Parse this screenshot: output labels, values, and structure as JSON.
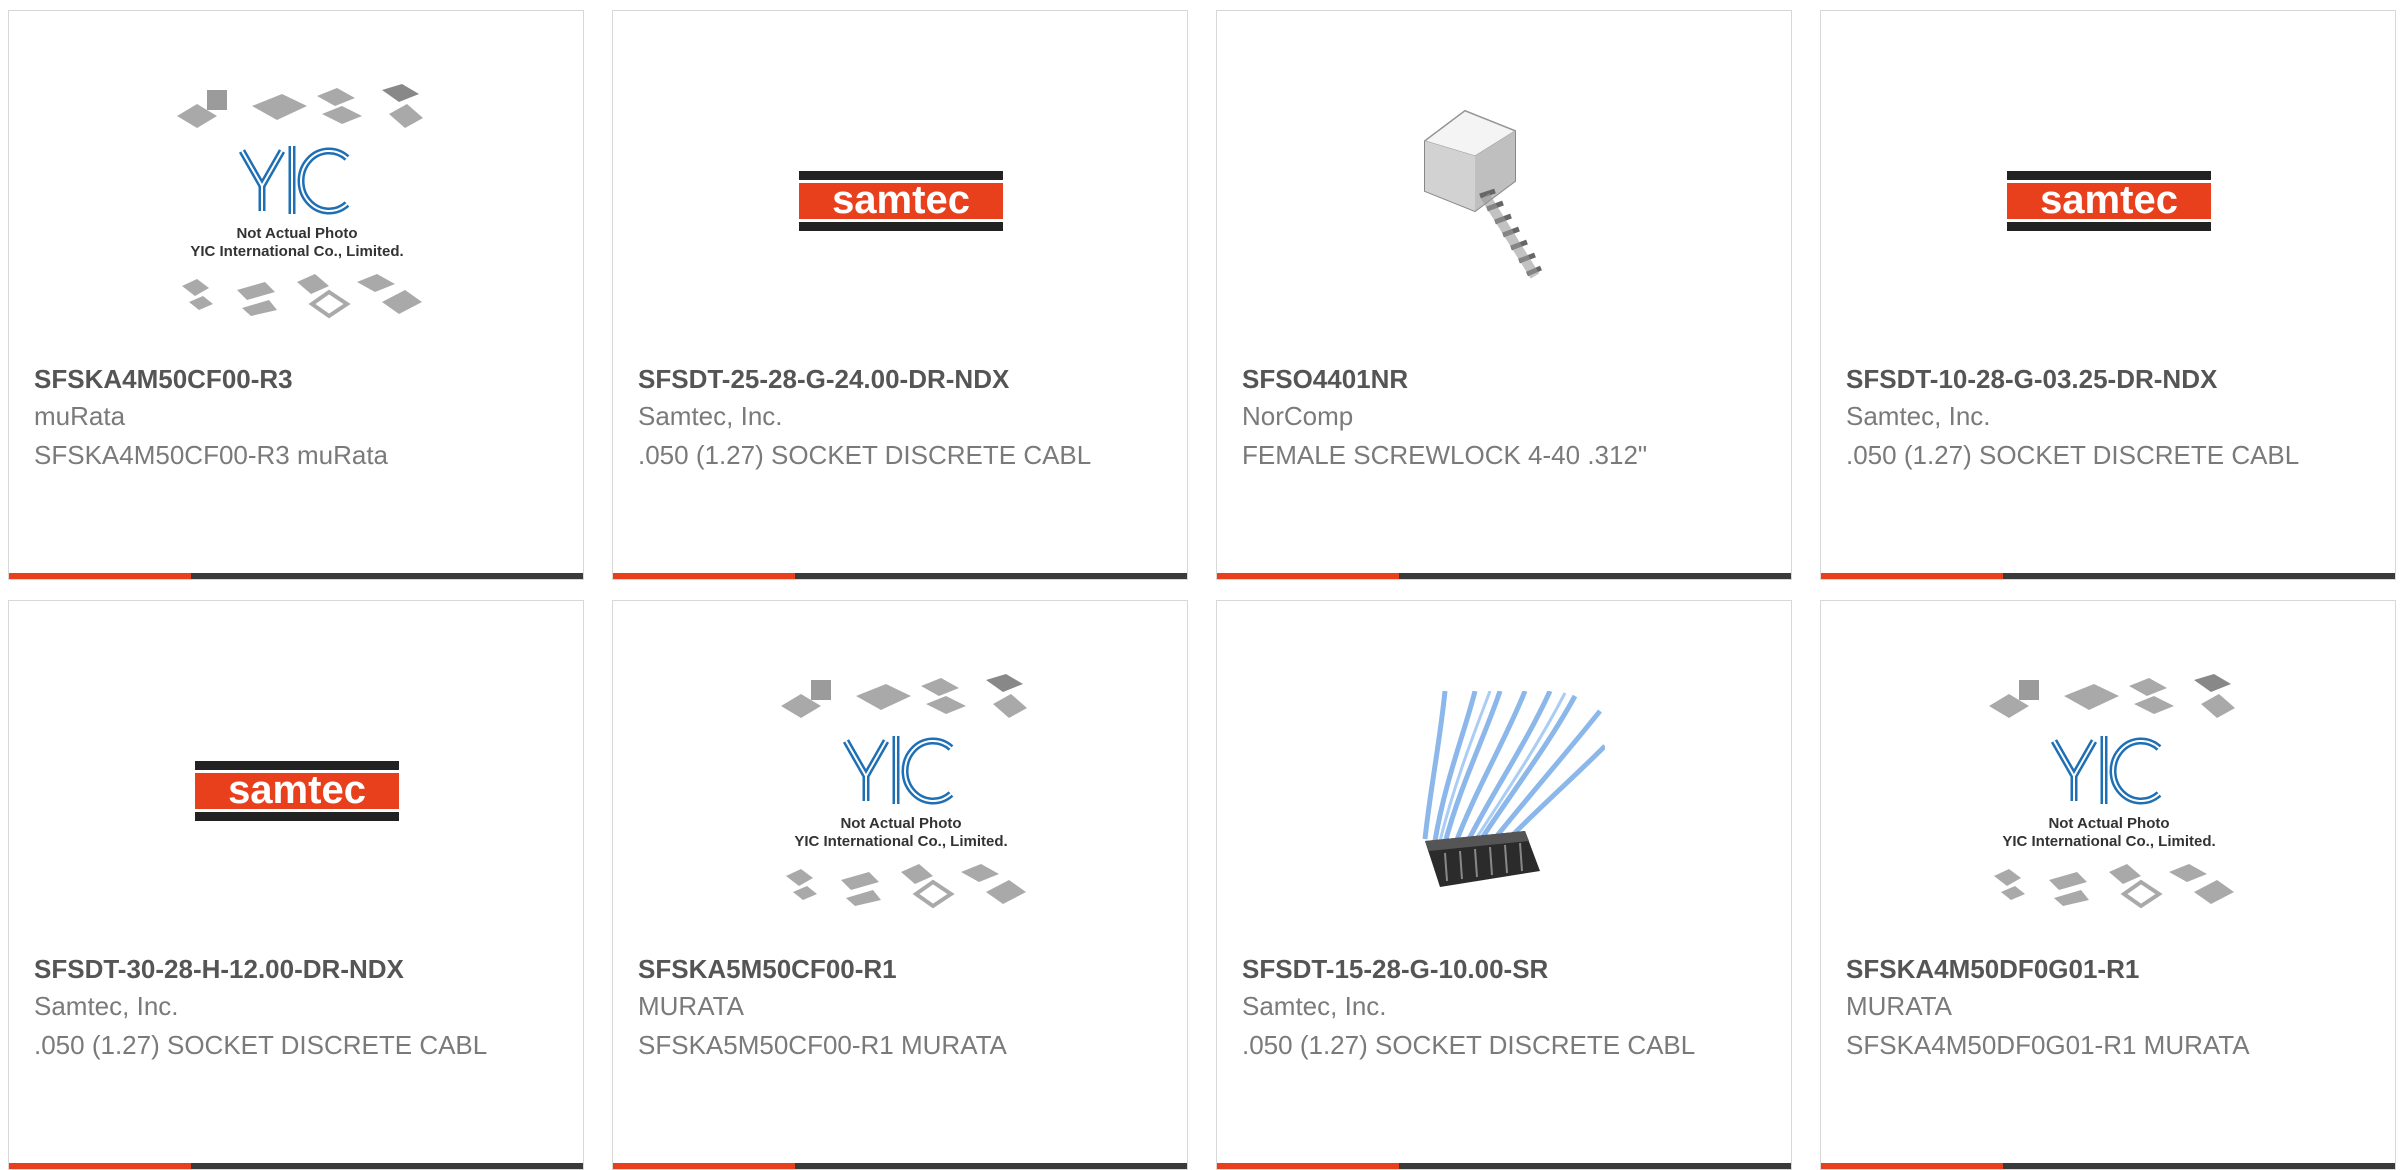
{
  "products": [
    {
      "part_number": "SFSKA4M50CF00-R3",
      "manufacturer": "muRata",
      "description": "SFSKA4M50CF00-R3 muRata",
      "image": "yic-placeholder-icon"
    },
    {
      "part_number": "SFSDT-25-28-G-24.00-DR-NDX",
      "manufacturer": "Samtec, Inc.",
      "description": ".050 (1.27) SOCKET DISCRETE CABL",
      "image": "samtec-logo"
    },
    {
      "part_number": "SFSO4401NR",
      "manufacturer": "NorComp",
      "description": "FEMALE SCREWLOCK 4-40 .312\"",
      "image": "screwlock-photo"
    },
    {
      "part_number": "SFSDT-10-28-G-03.25-DR-NDX",
      "manufacturer": "Samtec, Inc.",
      "description": ".050 (1.27) SOCKET DISCRETE CABL",
      "image": "samtec-logo"
    },
    {
      "part_number": "SFSDT-30-28-H-12.00-DR-NDX",
      "manufacturer": "Samtec, Inc.",
      "description": ".050 (1.27) SOCKET DISCRETE CABL",
      "image": "samtec-logo"
    },
    {
      "part_number": "SFSKA5M50CF00-R1",
      "manufacturer": "MURATA",
      "description": "SFSKA5M50CF00-R1 MURATA",
      "image": "yic-placeholder-icon"
    },
    {
      "part_number": "SFSDT-15-28-G-10.00-SR",
      "manufacturer": "Samtec, Inc.",
      "description": ".050 (1.27) SOCKET DISCRETE CABL",
      "image": "cable-assembly-photo"
    },
    {
      "part_number": "SFSKA4M50DF0G01-R1",
      "manufacturer": "MURATA",
      "description": "SFSKA4M50DF0G01-R1 MURATA",
      "image": "yic-placeholder-icon"
    }
  ],
  "logos": {
    "samtec_text": "samtec",
    "yic_text": "YIC",
    "yic_caption_1": "Not Actual Photo",
    "yic_caption_2": "YIC International Co., Limited."
  },
  "colors": {
    "accent": "#e8401c",
    "bar": "#3a3a3a",
    "samtec_orange": "#e8401c",
    "yic_blue": "#1f6fb5"
  }
}
